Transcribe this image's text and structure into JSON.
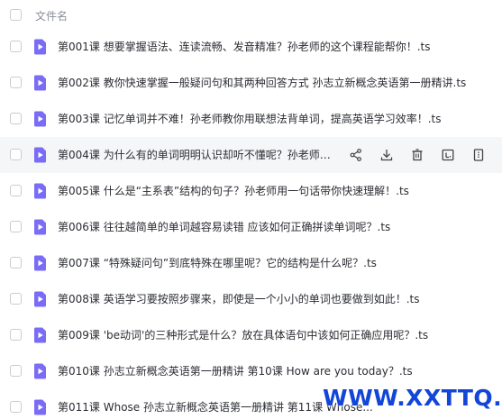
{
  "header": {
    "column_label": "文件名"
  },
  "files": [
    {
      "name": "第001课 想要掌握语法、连读流畅、发音精准？孙老师的这个课程能帮你！.ts"
    },
    {
      "name": "第002课 教你快速掌握一般疑问句和其两种回答方式 孙志立新概念英语第一册精讲.ts"
    },
    {
      "name": "第003课 记忆单词并不难！孙老师教你用联想法背单词，提高英语学习效率！.ts"
    },
    {
      "name": "第004课 为什么有的单词明明认识却听不懂呢？孙老师帮..."
    },
    {
      "name": "第005课 什么是“主系表”结构的句子？孙老师用一句话带你快速理解！.ts"
    },
    {
      "name": "第006课 往往越简单的单词越容易读错 应该如何正确拼读单词呢？.ts"
    },
    {
      "name": "第007课 “特殊疑问句”到底特殊在哪里呢？它的结构是什么呢？.ts"
    },
    {
      "name": "第008课 英语学习要按照步骤来，即使是一个小小的单词也要做到如此！.ts"
    },
    {
      "name": "第009课 'be动词'的三种形式是什么？放在具体语句中该如何正确应用呢？.ts"
    },
    {
      "name": "第010课 孙志立新概念英语第一册精讲 第10课 How are you today？.ts"
    },
    {
      "name": "第011课 Whose 孙志立新概念英语第一册精讲 第11课 Whose..."
    }
  ],
  "hover_actions": [
    {
      "icon": "share-icon"
    },
    {
      "icon": "download-icon"
    },
    {
      "icon": "delete-icon"
    },
    {
      "icon": "subtitle-icon"
    },
    {
      "icon": "more-icon"
    }
  ],
  "colors": {
    "file_icon": "#7b6cf6",
    "watermark": "#1346d8"
  },
  "watermark": {
    "text": "WWW.XXTTQ.COM"
  }
}
